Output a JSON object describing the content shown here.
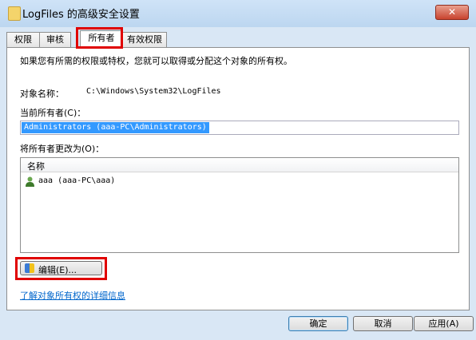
{
  "window": {
    "title": "LogFiles 的高级安全设置",
    "close_label": "✕"
  },
  "tabs": [
    {
      "label": "权限"
    },
    {
      "label": "审核"
    },
    {
      "label": "所有者"
    },
    {
      "label": "有效权限"
    }
  ],
  "owner_tab": {
    "intro": "如果您有所需的权限或特权，您就可以取得或分配这个对象的所有权。",
    "object_name_label": "对象名称：",
    "object_name_value": "C:\\Windows\\System32\\LogFiles",
    "current_owner_label": "当前所有者(C)：",
    "current_owner_value": "Administrators (aaa-PC\\Administrators)",
    "change_owner_label": "将所有者更改为(O)：",
    "list_header": "名称",
    "list_items": [
      {
        "label": "aaa (aaa-PC\\aaa)",
        "icon": "user-icon"
      }
    ],
    "edit_button": "编辑(E)...",
    "learn_more_link": "了解对象所有权的详细信息"
  },
  "footer": {
    "ok": "确定",
    "cancel": "取消",
    "apply": "应用(A)"
  },
  "colors": {
    "highlight": "#e00000",
    "selection": "#3399ff",
    "link": "#0066cc"
  }
}
